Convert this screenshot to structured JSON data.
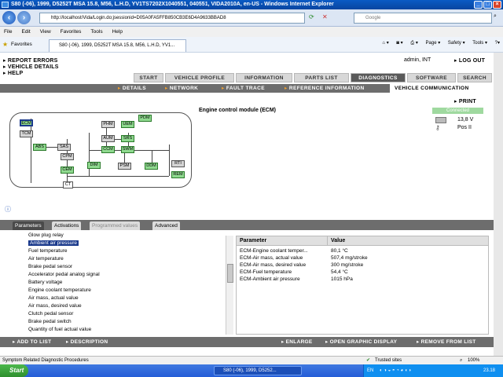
{
  "window": {
    "title": "S80 (-06), 1999, D5252T MSA 15.8, M56, L.H.D, YV1TS7202X1040551, 040551, VIDA2010A, en-US - Windows Internet Explorer"
  },
  "browser": {
    "url": "http://localhost/Vida/Login.do;jsessionid=D05A0FA5FFB850CB3E6D4A9633BBAD8",
    "search_placeholder": "Google",
    "menu": [
      "File",
      "Edit",
      "View",
      "Favorites",
      "Tools",
      "Help"
    ],
    "favorites_label": "Favorites",
    "tab_label": "S80 (-06), 1999, D5252T MSA 15.8, M56, L.H.D, YV1...",
    "cmd": [
      "Page ▾",
      "Safety ▾",
      "Tools ▾"
    ]
  },
  "app": {
    "links": [
      "REPORT ERRORS",
      "VEHICLE DETAILS",
      "HELP"
    ],
    "user": "admin, INT",
    "logout": "LOG OUT",
    "main_tabs": [
      "START",
      "VEHICLE PROFILE",
      "INFORMATION",
      "PARTS LIST",
      "DIAGNOSTICS",
      "SOFTWARE",
      "SEARCH"
    ],
    "sub_tabs": [
      "DETAILS",
      "NETWORK",
      "FAULT TRACE",
      "REFERENCE INFORMATION",
      "VEHICLE COMMUNICATION"
    ],
    "print": "PRINT",
    "module_title": "Engine control module (ECM)",
    "connection": {
      "status": "Connected",
      "voltage": "13,8 V",
      "key_position": "Pos II"
    },
    "nodes": [
      "ECM",
      "TCM",
      "ABS",
      "SAS",
      "CPM",
      "CEM",
      "CT",
      "PHM",
      "UEM",
      "PDM",
      "AUM",
      "SRS",
      "CCM",
      "SWM",
      "DIM",
      "PSM",
      "DDM",
      "RTI",
      "REM"
    ],
    "bottom_tabs": [
      "Parameters",
      "Activations",
      "Programmed values",
      "Advanced"
    ],
    "param_list": [
      "Glow plug relay",
      "Ambient air pressure",
      "Fuel temperature",
      "Air temperature",
      "Brake pedal sensor",
      "Accelerator pedal analog signal",
      "Battery voltage",
      "Engine coolant temperature",
      "Air mass, actual value",
      "Air mass, desired value",
      "Clutch pedal sensor",
      "Brake pedal switch",
      "Quantity of fuel actual value"
    ],
    "selected_param": "Ambient air pressure",
    "table": {
      "headers": [
        "Parameter",
        "Value"
      ],
      "rows": [
        [
          "ECM-Engine coolant temper...",
          "80,1 °C"
        ],
        [
          "ECM-Air mass, actual value",
          "507,4 mg/stroke"
        ],
        [
          "ECM-Air mass, desired value",
          "300 mg/stroke"
        ],
        [
          "ECM-Fuel temperature",
          "54,4 °C"
        ],
        [
          "ECM-Ambient air pressure",
          "1015 hPa"
        ]
      ]
    },
    "actions": [
      "ADD TO LIST",
      "DESCRIPTION",
      "ENLARGE",
      "OPEN GRAPHIC DISPLAY",
      "REMOVE FROM LIST"
    ]
  },
  "status": {
    "text": "Symptom Related Diagnostic Procedures",
    "zone": "Trusted sites",
    "zoom": "100%"
  },
  "taskbar": {
    "start": "Start",
    "item": "S80 (-06), 1999, D5252...",
    "lang": "EN",
    "clock": "23.18"
  }
}
